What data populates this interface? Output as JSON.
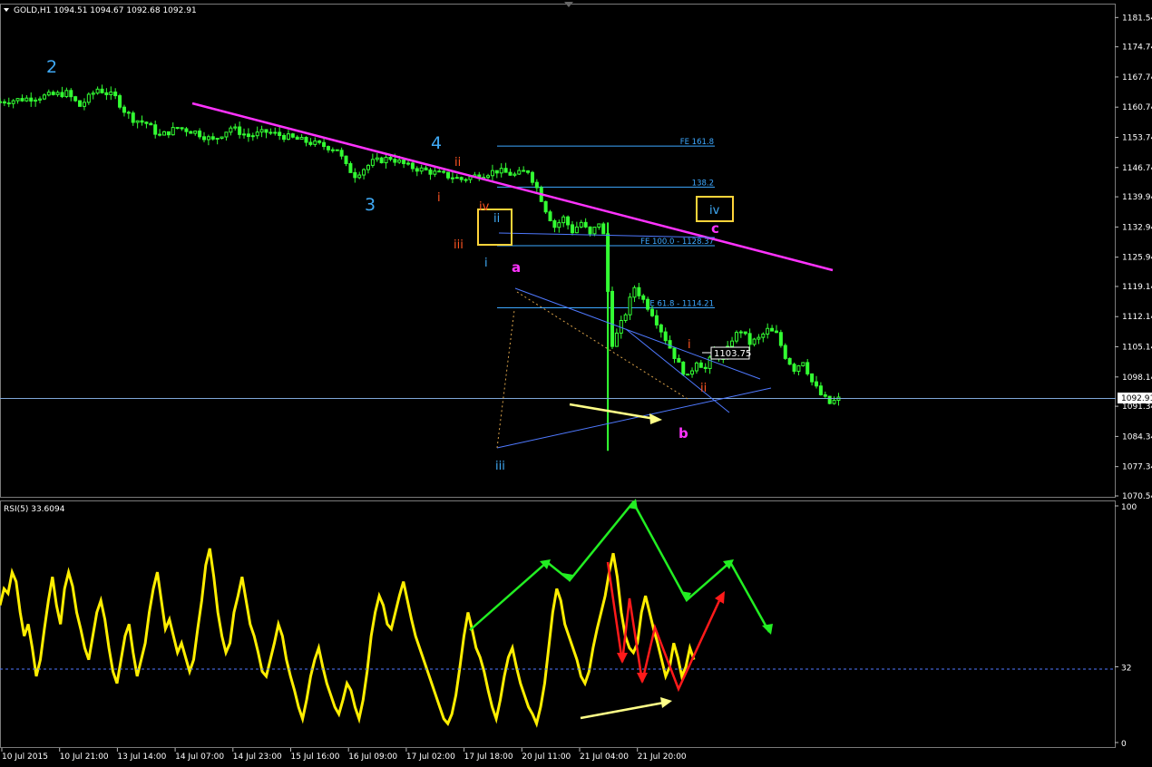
{
  "window": {
    "symbol_header": "GOLD,H1  1094.51 1094.67 1092.68 1092.91"
  },
  "colors": {
    "background": "#000000",
    "candle": "#33ff33",
    "trendline": "#ff33ff",
    "fib": "#3da8ff",
    "wave_count": "#3fa9f5",
    "subwave": "#ff5522",
    "box": "#ffd43a",
    "rsi": "#ffee00",
    "green_arrows": "#22ee22",
    "red_arrows": "#ff1a1a",
    "divergence_arrow": "#ffff88"
  },
  "chart_data": [
    {
      "type": "candlestick",
      "title": "GOLD,H1",
      "ohlc_header": "1094.51 1094.67 1092.68 1092.91",
      "ylim": [
        1070.54,
        1183.5
      ],
      "ytick_labels": [
        "1181.54",
        "1174.74",
        "1167.74",
        "1160.74",
        "1153.74",
        "1146.74",
        "1139.94",
        "1132.94",
        "1125.94",
        "1119.14",
        "1112.14",
        "1105.14",
        "1098.14",
        "1091.34",
        "1084.34",
        "1077.34",
        "1070.54"
      ],
      "current_price_label": "1092.91",
      "current_price": 1092.91,
      "price_box": "1103.75",
      "close_path": [
        [
          0,
          1162
        ],
        [
          8,
          1163
        ],
        [
          15,
          1164
        ],
        [
          18,
          1161
        ],
        [
          22,
          1165
        ],
        [
          26,
          1163
        ],
        [
          28,
          1160
        ],
        [
          30,
          1158
        ],
        [
          33,
          1157
        ],
        [
          36,
          1154
        ],
        [
          40,
          1156
        ],
        [
          44,
          1155
        ],
        [
          48,
          1153
        ],
        [
          52,
          1156
        ],
        [
          56,
          1154
        ],
        [
          60,
          1155
        ],
        [
          64,
          1154
        ],
        [
          68,
          1153
        ],
        [
          72,
          1152
        ],
        [
          76,
          1151
        ],
        [
          78,
          1147
        ],
        [
          80,
          1145
        ],
        [
          84,
          1148
        ],
        [
          88,
          1149
        ],
        [
          92,
          1147
        ],
        [
          96,
          1146
        ],
        [
          100,
          1145
        ],
        [
          104,
          1144
        ],
        [
          108,
          1145
        ],
        [
          112,
          1146
        ],
        [
          116,
          1145
        ],
        [
          119,
          1146
        ],
        [
          121,
          1142
        ],
        [
          123,
          1137
        ],
        [
          125,
          1133
        ],
        [
          127,
          1135
        ],
        [
          129,
          1132
        ],
        [
          131,
          1134
        ],
        [
          133,
          1131
        ],
        [
          135,
          1134
        ],
        [
          136,
          1131
        ],
        [
          137,
          1118
        ],
        [
          137.5,
          1105
        ],
        [
          139,
          1108
        ],
        [
          141,
          1113
        ],
        [
          143,
          1119
        ],
        [
          145,
          1116
        ],
        [
          147,
          1113
        ],
        [
          149,
          1109
        ],
        [
          151,
          1105
        ],
        [
          153,
          1101
        ],
        [
          155,
          1098
        ],
        [
          157,
          1102
        ],
        [
          159,
          1100
        ],
        [
          161,
          1104
        ],
        [
          163,
          1102
        ],
        [
          165,
          1107
        ],
        [
          167,
          1109
        ],
        [
          169,
          1106
        ],
        [
          171,
          1107
        ],
        [
          173,
          1109
        ],
        [
          175,
          1108
        ],
        [
          177,
          1103
        ],
        [
          179,
          1100
        ],
        [
          181,
          1102
        ],
        [
          183,
          1097
        ],
        [
          185,
          1094
        ],
        [
          187,
          1092
        ],
        [
          189,
          1093
        ]
      ],
      "bar_count": 190,
      "wave_labels_primary": [
        "2",
        "3",
        "4"
      ],
      "wave_labels_minor": [
        "i",
        "ii",
        "iii",
        "iv"
      ],
      "wave_labels_sub": [
        "i",
        "ii",
        "iii",
        "iv",
        "i",
        "ii"
      ],
      "corrective_labels": [
        "a",
        "b",
        "c"
      ],
      "fib_levels": [
        {
          "label": "FE 161.8",
          "price": 1151.7
        },
        {
          "label": "138.2",
          "price": 1142.2
        },
        {
          "label": "FE 100.0 - 1128.37",
          "price": 1128.6
        },
        {
          "label": "FE 61.8 - 1114.21",
          "price": 1114.2
        }
      ],
      "x_range": [
        0,
        230
      ]
    },
    {
      "type": "line",
      "title": "RSI(5) 33.6094",
      "series_name": "RSI(5)",
      "last_value": 33.6094,
      "ylim": [
        0,
        100
      ],
      "ytick_labels": [
        "100",
        "32",
        "0"
      ],
      "level": 32,
      "values": [
        58,
        65,
        63,
        72,
        68,
        55,
        45,
        50,
        40,
        28,
        35,
        48,
        60,
        70,
        58,
        50,
        65,
        72,
        66,
        55,
        48,
        40,
        35,
        45,
        55,
        60,
        52,
        40,
        30,
        25,
        35,
        45,
        50,
        38,
        28,
        35,
        42,
        55,
        65,
        72,
        60,
        48,
        52,
        45,
        38,
        42,
        36,
        30,
        35,
        48,
        60,
        75,
        82,
        70,
        55,
        45,
        38,
        42,
        55,
        62,
        70,
        60,
        50,
        45,
        38,
        30,
        28,
        35,
        42,
        50,
        45,
        35,
        28,
        22,
        15,
        10,
        18,
        28,
        35,
        40,
        32,
        25,
        20,
        15,
        12,
        18,
        25,
        22,
        15,
        10,
        18,
        30,
        45,
        55,
        62,
        58,
        50,
        48,
        55,
        62,
        68,
        60,
        52,
        45,
        40,
        35,
        30,
        25,
        20,
        15,
        10,
        8,
        12,
        20,
        32,
        45,
        55,
        48,
        40,
        36,
        30,
        22,
        15,
        10,
        18,
        28,
        36,
        40,
        32,
        25,
        20,
        15,
        12,
        8,
        15,
        25,
        40,
        55,
        65,
        60,
        50,
        45,
        40,
        35,
        28,
        25,
        30,
        40,
        48,
        55,
        62,
        72,
        80,
        70,
        55,
        45,
        40,
        38,
        42,
        55,
        62,
        55,
        48,
        42,
        35,
        28,
        32,
        42,
        36,
        28,
        32,
        40,
        35
      ],
      "x_axis_labels": [
        "10 Jul 2015",
        "10 Jul 21:00",
        "13 Jul 14:00",
        "14 Jul 07:00",
        "14 Jul 23:00",
        "15 Jul 16:00",
        "16 Jul 09:00",
        "17 Jul 02:00",
        "17 Jul 18:00",
        "20 Jul 11:00",
        "21 Jul 04:00",
        "21 Jul 20:00"
      ]
    }
  ]
}
